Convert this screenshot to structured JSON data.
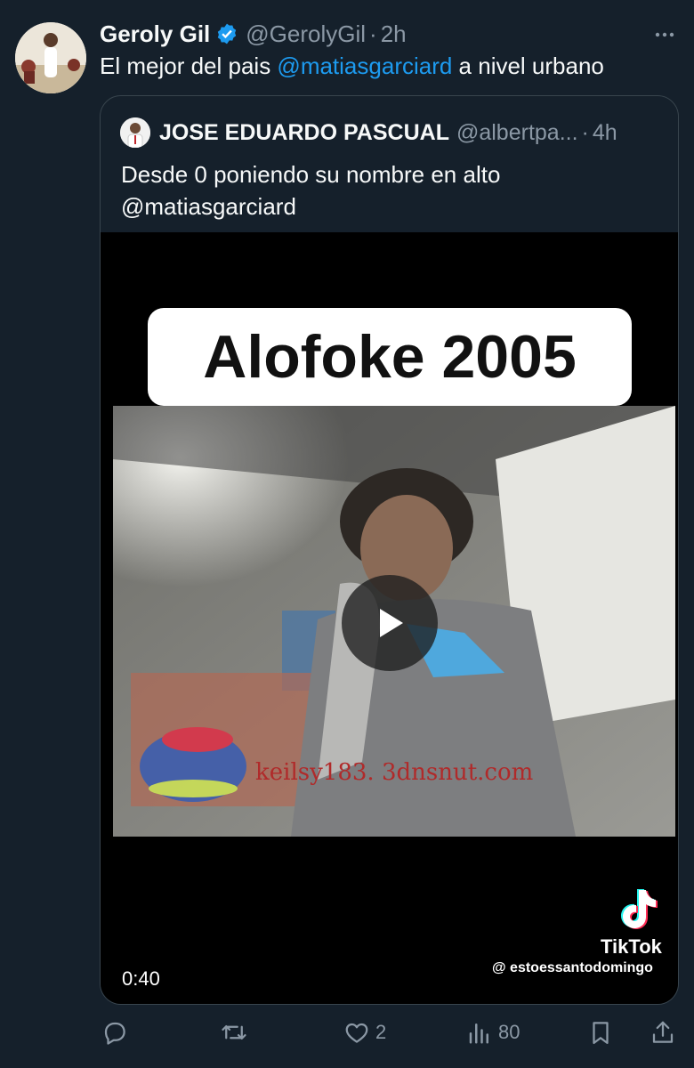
{
  "tweet": {
    "author_name": "Geroly Gil",
    "author_handle": "@GerolyGil",
    "separator": "·",
    "time": "2h",
    "text_before": "El mejor del pais ",
    "mention": "@matiasgarciard",
    "text_after": " a nivel urbano"
  },
  "quote": {
    "author_name": "JOSE EDUARDO PASCUAL",
    "author_handle": "@albertpa...",
    "separator": "·",
    "time": "4h",
    "text_line1": "Desde 0 poniendo su nombre en alto",
    "text_line2": "@matiasgarciard"
  },
  "video": {
    "overlay_title": "Alofoke 2005",
    "duration": "0:40",
    "watermark_brand": "TikTok",
    "watermark_user": "@ estoessantodomingo",
    "frame_caption": "keilsy183. 3dnsnut.com"
  },
  "actions": {
    "reply_count": "",
    "retweet_count": "",
    "like_count": "2",
    "views_count": "80"
  },
  "colors": {
    "background": "#15202b",
    "accent": "#1d9bf0",
    "secondary_text": "#8b98a5"
  }
}
